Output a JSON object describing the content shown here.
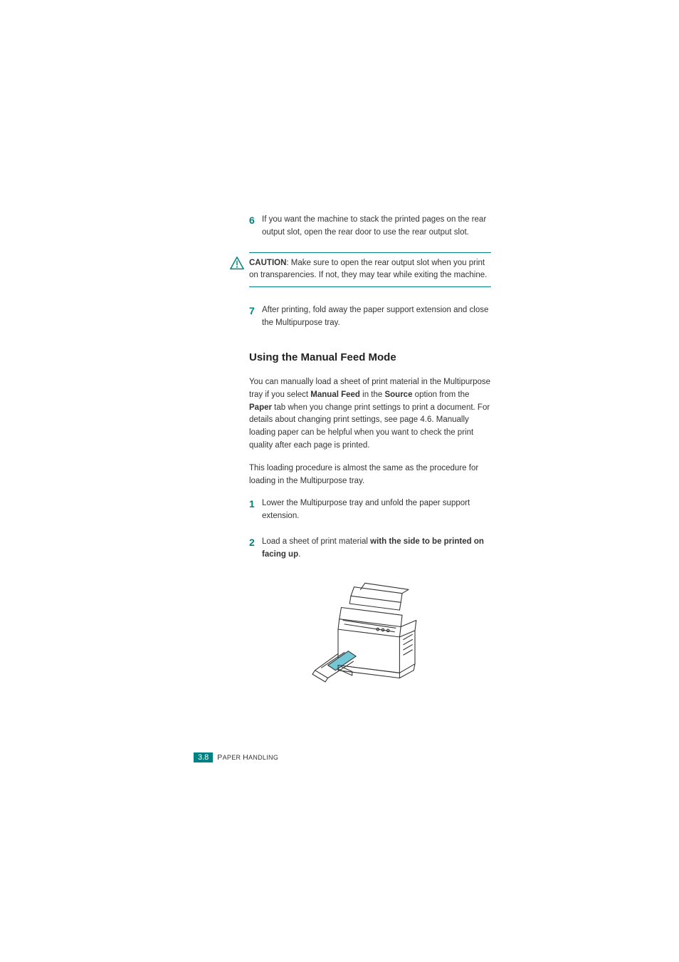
{
  "steps_top": [
    {
      "num": "6",
      "text": "If you want the machine to stack the printed pages on the rear output slot, open the rear door to use the rear output slot."
    }
  ],
  "caution": {
    "label": "CAUTION",
    "text": ": Make sure to open the rear output slot when you print on transparencies. If not, they may tear while exiting the machine."
  },
  "steps_mid": [
    {
      "num": "7",
      "text": "After printing, fold away the paper support extension and close the Multipurpose tray."
    }
  ],
  "section_heading": "Using the Manual Feed Mode",
  "para1": {
    "pre": "You can manually load a sheet of print material in the Multipurpose tray if you select ",
    "b1": "Manual Feed",
    "mid1": " in the ",
    "b2": "Source",
    "mid2": " option from the ",
    "b3": "Paper",
    "post": " tab when you change print settings to print a document. For details about changing print settings, see page 4.6. Manually loading paper can be helpful when you want to check the print quality after each page is printed."
  },
  "para2": "This loading procedure is almost the same as the procedure for loading in the Multipurpose tray.",
  "steps_bottom": [
    {
      "num": "1",
      "text": "Lower the Multipurpose tray and unfold the paper support extension."
    },
    {
      "num": "2",
      "pre": "Load a sheet of print material ",
      "bold": "with the side to be printed on facing up",
      "post": "."
    }
  ],
  "footer": {
    "page_num": "3.8",
    "chapter_prefix": "P",
    "chapter_rest": "APER ",
    "chapter_prefix2": "H",
    "chapter_rest2": "ANDLING"
  }
}
